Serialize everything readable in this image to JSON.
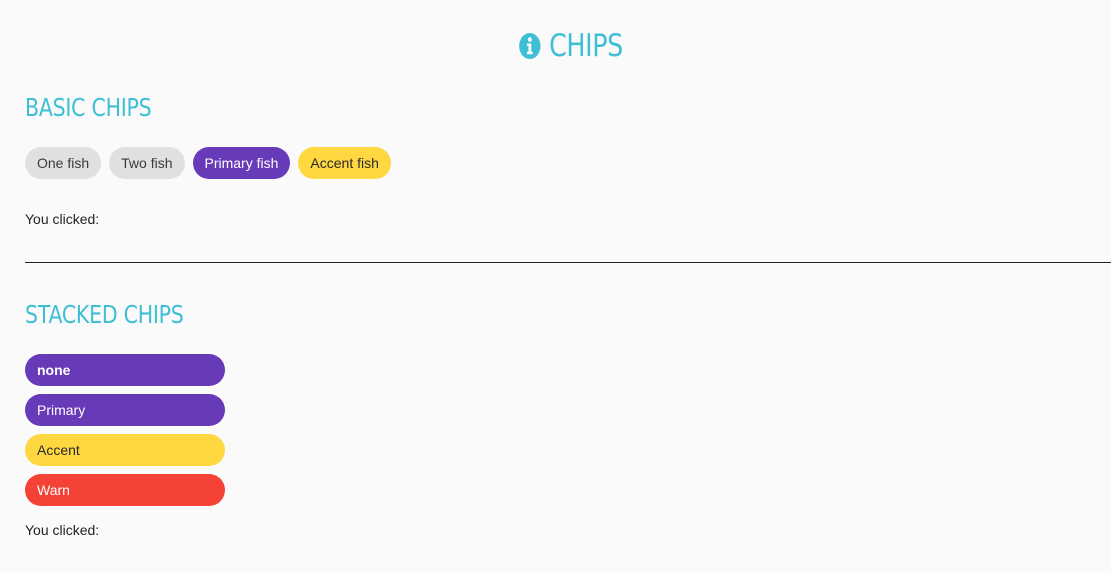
{
  "header": {
    "title": "CHIPS",
    "icon": "info-circle-icon",
    "accent_color": "#3ebfd6"
  },
  "basic": {
    "title": "BASIC CHIPS",
    "chips": [
      {
        "label": "One fish",
        "color": "default"
      },
      {
        "label": "Two fish",
        "color": "default"
      },
      {
        "label": "Primary fish",
        "color": "primary"
      },
      {
        "label": "Accent fish",
        "color": "accent"
      }
    ],
    "clicked_label": "You clicked:"
  },
  "stacked": {
    "title": "STACKED CHIPS",
    "chips": [
      {
        "label": "none",
        "color": "primary"
      },
      {
        "label": "Primary",
        "color": "primary"
      },
      {
        "label": "Accent",
        "color": "accent"
      },
      {
        "label": "Warn",
        "color": "warn"
      }
    ],
    "clicked_label": "You clicked:"
  },
  "colors": {
    "primary": "#673ab7",
    "accent": "#ffd740",
    "warn": "#f44336",
    "default": "#e0e0e0"
  }
}
